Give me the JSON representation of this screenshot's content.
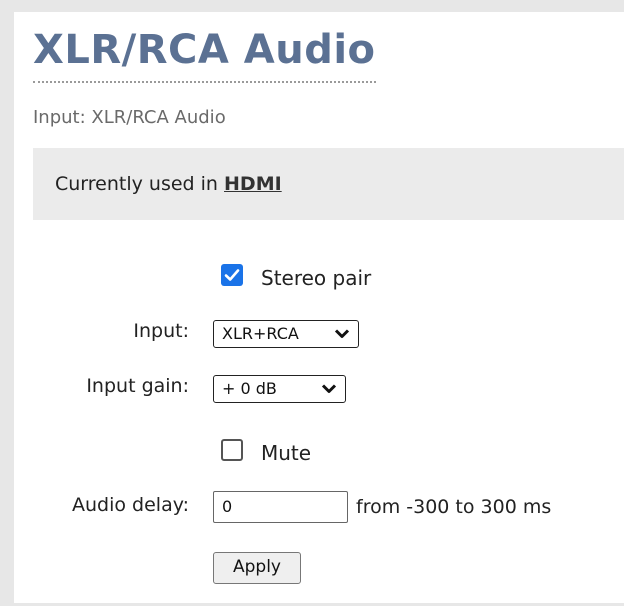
{
  "page": {
    "title": "XLR/RCA Audio",
    "subtitle": "Input: XLR/RCA Audio"
  },
  "usage": {
    "prefix": "Currently used in ",
    "link": "HDMI"
  },
  "form": {
    "stereo_pair": {
      "label": "Stereo pair",
      "checked": true
    },
    "input": {
      "label": "Input:",
      "selected": "XLR+RCA"
    },
    "input_gain": {
      "label": "Input gain:",
      "selected": "+ 0 dB"
    },
    "mute": {
      "label": "Mute",
      "checked": false
    },
    "audio_delay": {
      "label": "Audio delay:",
      "value": "0",
      "hint": "from -300 to 300 ms"
    },
    "apply_label": "Apply"
  },
  "colors": {
    "title": "#5b7193",
    "checkbox_accent": "#1a73e8",
    "usage_bar": "#ebebeb"
  }
}
